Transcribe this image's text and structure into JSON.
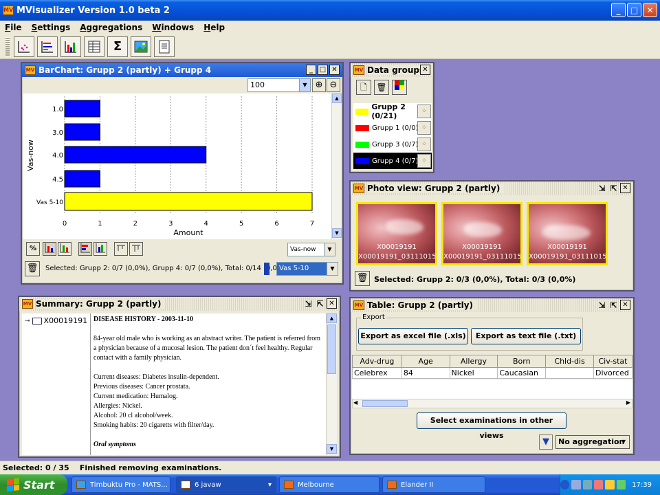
{
  "app": {
    "title": "MVisualizer Version 1.0 beta 2",
    "icon": "mv-app-icon",
    "window_controls": [
      "minimize",
      "maximize",
      "close"
    ]
  },
  "menu": [
    "File",
    "Settings",
    "Aggregations",
    "Windows",
    "Help"
  ],
  "toolbar": {
    "buttons": [
      "scatter-plot-icon",
      "parallel-coords-icon",
      "bar-chart-icon",
      "table-icon",
      "sigma-icon",
      "photo-icon",
      "document-icon"
    ]
  },
  "barchart": {
    "title": "BarChart: Grupp 2 (partly) + Grupp 4",
    "zoom_value": "100",
    "status": "Selected: Grupp 2: 0/7 (0,0%), Grupp 4: 0/7 (0,0%), Total: 0/14 (0,0%)",
    "y_axis_select": "Vas-now",
    "category_select": "Vas 5-10",
    "percent_label": "%"
  },
  "chart_data": {
    "type": "bar",
    "orientation": "horizontal",
    "categories": [
      "1.0",
      "3.0",
      "4.0",
      "4.5",
      "Vas 5-10"
    ],
    "values": [
      1,
      1,
      4,
      1,
      7
    ],
    "colors": [
      "#0000ff",
      "#0000ff",
      "#0000ff",
      "#0000ff",
      "#ffff00"
    ],
    "xlabel": "Amount",
    "ylabel": "Vas-now",
    "xlim": [
      0,
      7
    ],
    "xticks": [
      "0",
      "1",
      "2",
      "3",
      "4",
      "5",
      "6",
      "7"
    ],
    "grid": "vertical dashed"
  },
  "datagroups": {
    "title": "Data groups",
    "items": [
      {
        "label": "Grupp 2 (0/21)",
        "color": "#ffff00",
        "bold": true,
        "selected": false
      },
      {
        "label": "Grupp 1 (0/0)",
        "color": "#ff0000",
        "bold": false,
        "selected": false
      },
      {
        "label": "Grupp 3 (0/7)",
        "color": "#00ff00",
        "bold": false,
        "selected": false
      },
      {
        "label": "Grupp 4 (0/7)",
        "color": "#0000ff",
        "bold": false,
        "selected": true
      }
    ]
  },
  "photoview": {
    "title": "Photo view: Grupp 2 (partly)",
    "photos": [
      {
        "id": "X00019191",
        "file": "X00019191_03111015..."
      },
      {
        "id": "X00019191",
        "file": "X00019191_03111015..."
      },
      {
        "id": "X00019191",
        "file": "X00019191_03111015..."
      }
    ],
    "status": "Selected: Grupp 2: 0/3 (0,0%), Total: 0/3 (0,0%)"
  },
  "summary": {
    "title": "Summary: Grupp 2 (partly)",
    "tree_item": "X00019191",
    "heading": "DISEASE HISTORY - 2003-11-10",
    "para1": "84-year old male who is working as an abstract writer. The patient is referred from a physician because of  a mucosal lesion. The patient don´t feel healthy. Regular contact with a family physician.",
    "lines": [
      "Current diseases: Diabetes insulin-dependent.",
      "Previous diseases: Cancer prostata.",
      "Current medication: Humalog.",
      "Allergies: Nickel.",
      "Alcohol: 20 cl alcohol/week.",
      "Smoking habits: 20 cigaretts with filter/day."
    ],
    "subheading": "Oral symptoms"
  },
  "table": {
    "title": "Table: Grupp 2 (partly)",
    "export_label": "Export",
    "export_excel": "Export as excel file (.xls)",
    "export_text": "Export as text file (.txt)",
    "columns": [
      "Adv-drug",
      "Age",
      "Allergy",
      "Born",
      "Chld-dis",
      "Civ-stat"
    ],
    "rows": [
      [
        "Celebrex",
        "84",
        "Nickel",
        "Caucasian",
        "",
        "Divorced"
      ]
    ],
    "select_button": "Select examinations in other views",
    "aggregation": "No aggregation"
  },
  "statusbar": {
    "text": "Selected: 0 / 35    Finished removing examinations."
  },
  "taskbar": {
    "start": "Start",
    "tasks": [
      "Timbuktu Pro - MATS...",
      "6 javaw",
      "Melbourne",
      "Elander II"
    ],
    "clock": "17:39"
  }
}
